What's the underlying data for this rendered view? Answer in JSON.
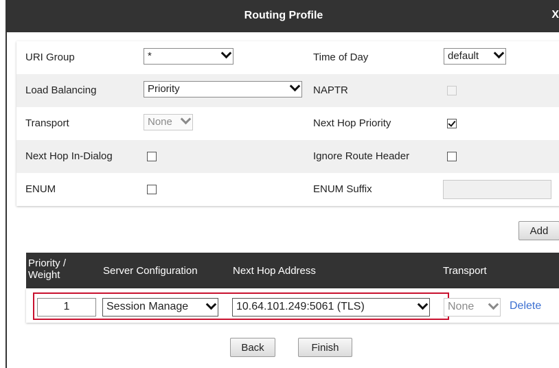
{
  "dialog": {
    "title": "Routing Profile",
    "close_label": "X"
  },
  "form": {
    "uri_group": {
      "label": "URI Group",
      "value": "*"
    },
    "time_of_day": {
      "label": "Time of Day",
      "value": "default"
    },
    "load_balancing": {
      "label": "Load Balancing",
      "value": "Priority"
    },
    "naptr": {
      "label": "NAPTR",
      "checked": false,
      "disabled": true
    },
    "transport": {
      "label": "Transport",
      "value": "None",
      "disabled": true
    },
    "next_hop_priority": {
      "label": "Next Hop Priority",
      "checked": true
    },
    "next_hop_in_dialog": {
      "label": "Next Hop In-Dialog",
      "checked": false
    },
    "ignore_route_header": {
      "label": "Ignore Route Header",
      "checked": false
    },
    "enum": {
      "label": "ENUM",
      "checked": false
    },
    "enum_suffix": {
      "label": "ENUM Suffix",
      "value": ""
    }
  },
  "buttons": {
    "add": "Add",
    "back": "Back",
    "finish": "Finish"
  },
  "table": {
    "headers": {
      "priority_line1": "Priority /",
      "priority_line2": "Weight",
      "server_configuration": "Server Configuration",
      "next_hop_address": "Next Hop Address",
      "transport": "Transport"
    },
    "rows": [
      {
        "priority": "1",
        "server_configuration": "Session Manage",
        "next_hop_address": "10.64.101.249:5061 (TLS)",
        "transport": "None",
        "action": "Delete"
      }
    ]
  },
  "colors": {
    "header_bg": "#333333",
    "highlight_border": "#c8102e",
    "link": "#3b6fd1"
  }
}
